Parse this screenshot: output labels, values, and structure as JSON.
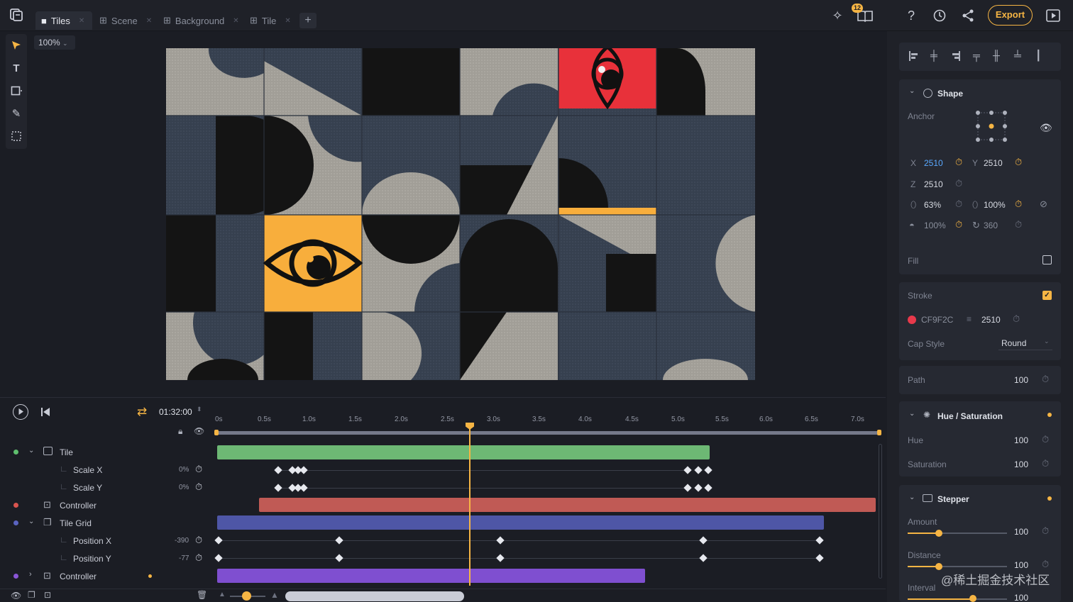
{
  "tabs": [
    {
      "label": "Tiles",
      "active": true
    },
    {
      "label": "Scene",
      "active": false
    },
    {
      "label": "Background",
      "active": false
    },
    {
      "label": "Tile",
      "active": false
    }
  ],
  "topbar": {
    "notification_count": "12",
    "export_label": "Export"
  },
  "canvas": {
    "zoom": "100%"
  },
  "panel": {
    "shape_title": "Shape",
    "anchor_label": "Anchor",
    "x_label": "X",
    "x_value": "2510",
    "y_label": "Y",
    "y_value": "2510",
    "z_label": "Z",
    "z_value": "2510",
    "scale_x": "63%",
    "scale_y": "100%",
    "opacity": "100%",
    "rotation": "360",
    "fill_label": "Fill",
    "stroke_label": "Stroke",
    "stroke_color": "CF9F2C",
    "stroke_width": "2510",
    "cap_style_label": "Cap Style",
    "cap_style_value": "Round",
    "path_label": "Path",
    "path_value": "100",
    "hue_sat_title": "Hue / Saturation",
    "hue_label": "Hue",
    "hue_value": "100",
    "saturation_label": "Saturation",
    "saturation_value": "100",
    "stepper_title": "Stepper",
    "amount_label": "Amount",
    "amount_value": "100",
    "distance_label": "Distance",
    "distance_value": "100",
    "interval_label": "Interval",
    "interval_value": "100"
  },
  "timeline": {
    "time": "01:32:00",
    "ticks": [
      "0s",
      "0.5s",
      "1.0s",
      "1.5s",
      "2.0s",
      "2.5s",
      "3.0s",
      "3.5s",
      "4.0s",
      "4.5s",
      "5.0s",
      "5.5s",
      "6.0s",
      "6.5s",
      "7.0s"
    ],
    "layers": [
      {
        "name": "Tile",
        "dot": "#5fbf6e"
      },
      {
        "name": "Scale X",
        "value": "0%"
      },
      {
        "name": "Scale Y",
        "value": "0%"
      },
      {
        "name": "Controller",
        "dot": "#d9544f"
      },
      {
        "name": "Tile Grid",
        "dot": "#5a63c0"
      },
      {
        "name": "Position X",
        "value": "-390"
      },
      {
        "name": "Position Y",
        "value": "-77"
      },
      {
        "name": "Controller",
        "dot": "#8a56d6"
      }
    ]
  },
  "watermark": "@稀土掘金技术社区",
  "colors": {
    "accent": "#f6b544",
    "green": "#6db874",
    "red": "#c05a55",
    "blue": "#4e56a6",
    "purple": "#7f4fd0",
    "tile_red": "#e8313a",
    "tile_orange": "#f8ae3c"
  }
}
